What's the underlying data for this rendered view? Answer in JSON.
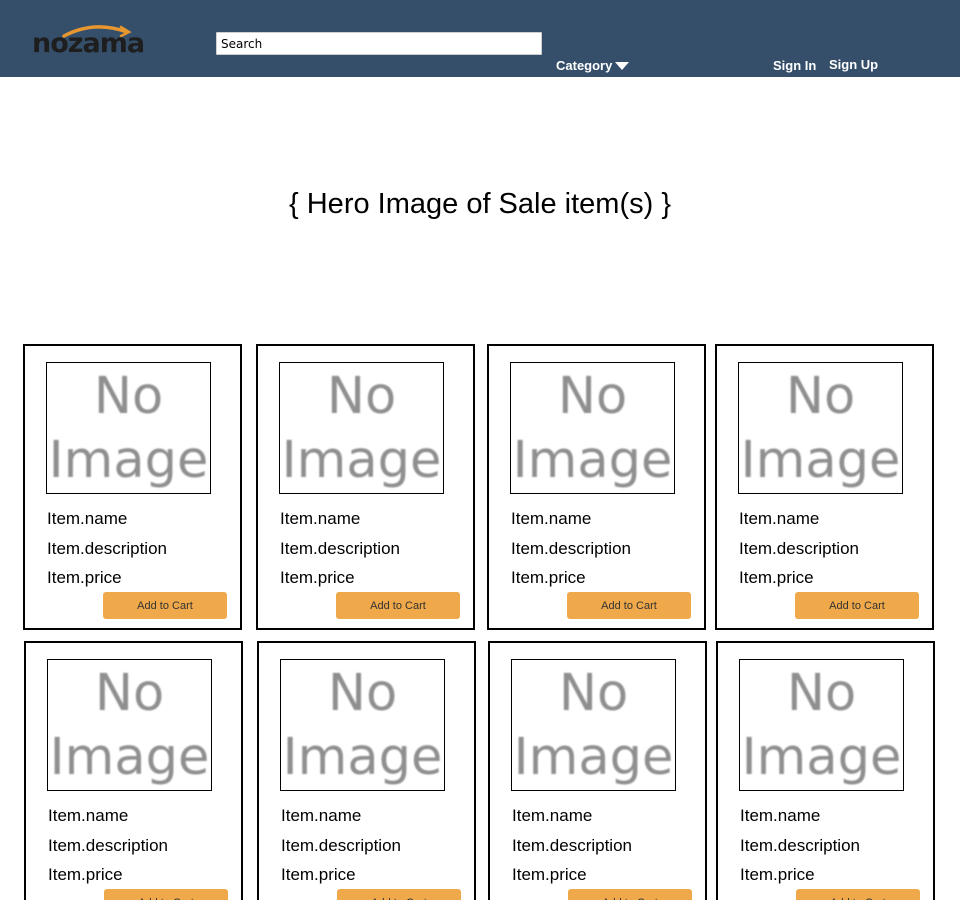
{
  "header": {
    "logo_text": "nozama",
    "search_placeholder": "Search",
    "category_label": "Category",
    "signin_label": "Sign In",
    "signup_label": "Sign Up"
  },
  "hero": {
    "text": "{ Hero Image of Sale item(s) }"
  },
  "colors": {
    "header_bg": "#354f6b",
    "logo_arc": "#e8962e",
    "button_bg": "#efa84a"
  },
  "products": [
    {
      "image_line1": "No",
      "image_line2": "Image",
      "name": "Item.name",
      "description": "Item.description",
      "price": "Item.price",
      "button": "Add to Cart"
    },
    {
      "image_line1": "No",
      "image_line2": "Image",
      "name": "Item.name",
      "description": "Item.description",
      "price": "Item.price",
      "button": "Add to Cart"
    },
    {
      "image_line1": "No",
      "image_line2": "Image",
      "name": "Item.name",
      "description": "Item.description",
      "price": "Item.price",
      "button": "Add to Cart"
    },
    {
      "image_line1": "No",
      "image_line2": "Image",
      "name": "Item.name",
      "description": "Item.description",
      "price": "Item.price",
      "button": "Add to Cart"
    },
    {
      "image_line1": "No",
      "image_line2": "Image",
      "name": "Item.name",
      "description": "Item.description",
      "price": "Item.price",
      "button": "Add to Cart"
    },
    {
      "image_line1": "No",
      "image_line2": "Image",
      "name": "Item.name",
      "description": "Item.description",
      "price": "Item.price",
      "button": "Add to Cart"
    },
    {
      "image_line1": "No",
      "image_line2": "Image",
      "name": "Item.name",
      "description": "Item.description",
      "price": "Item.price",
      "button": "Add to Cart"
    },
    {
      "image_line1": "No",
      "image_line2": "Image",
      "name": "Item.name",
      "description": "Item.description",
      "price": "Item.price",
      "button": "Add to Cart"
    }
  ]
}
